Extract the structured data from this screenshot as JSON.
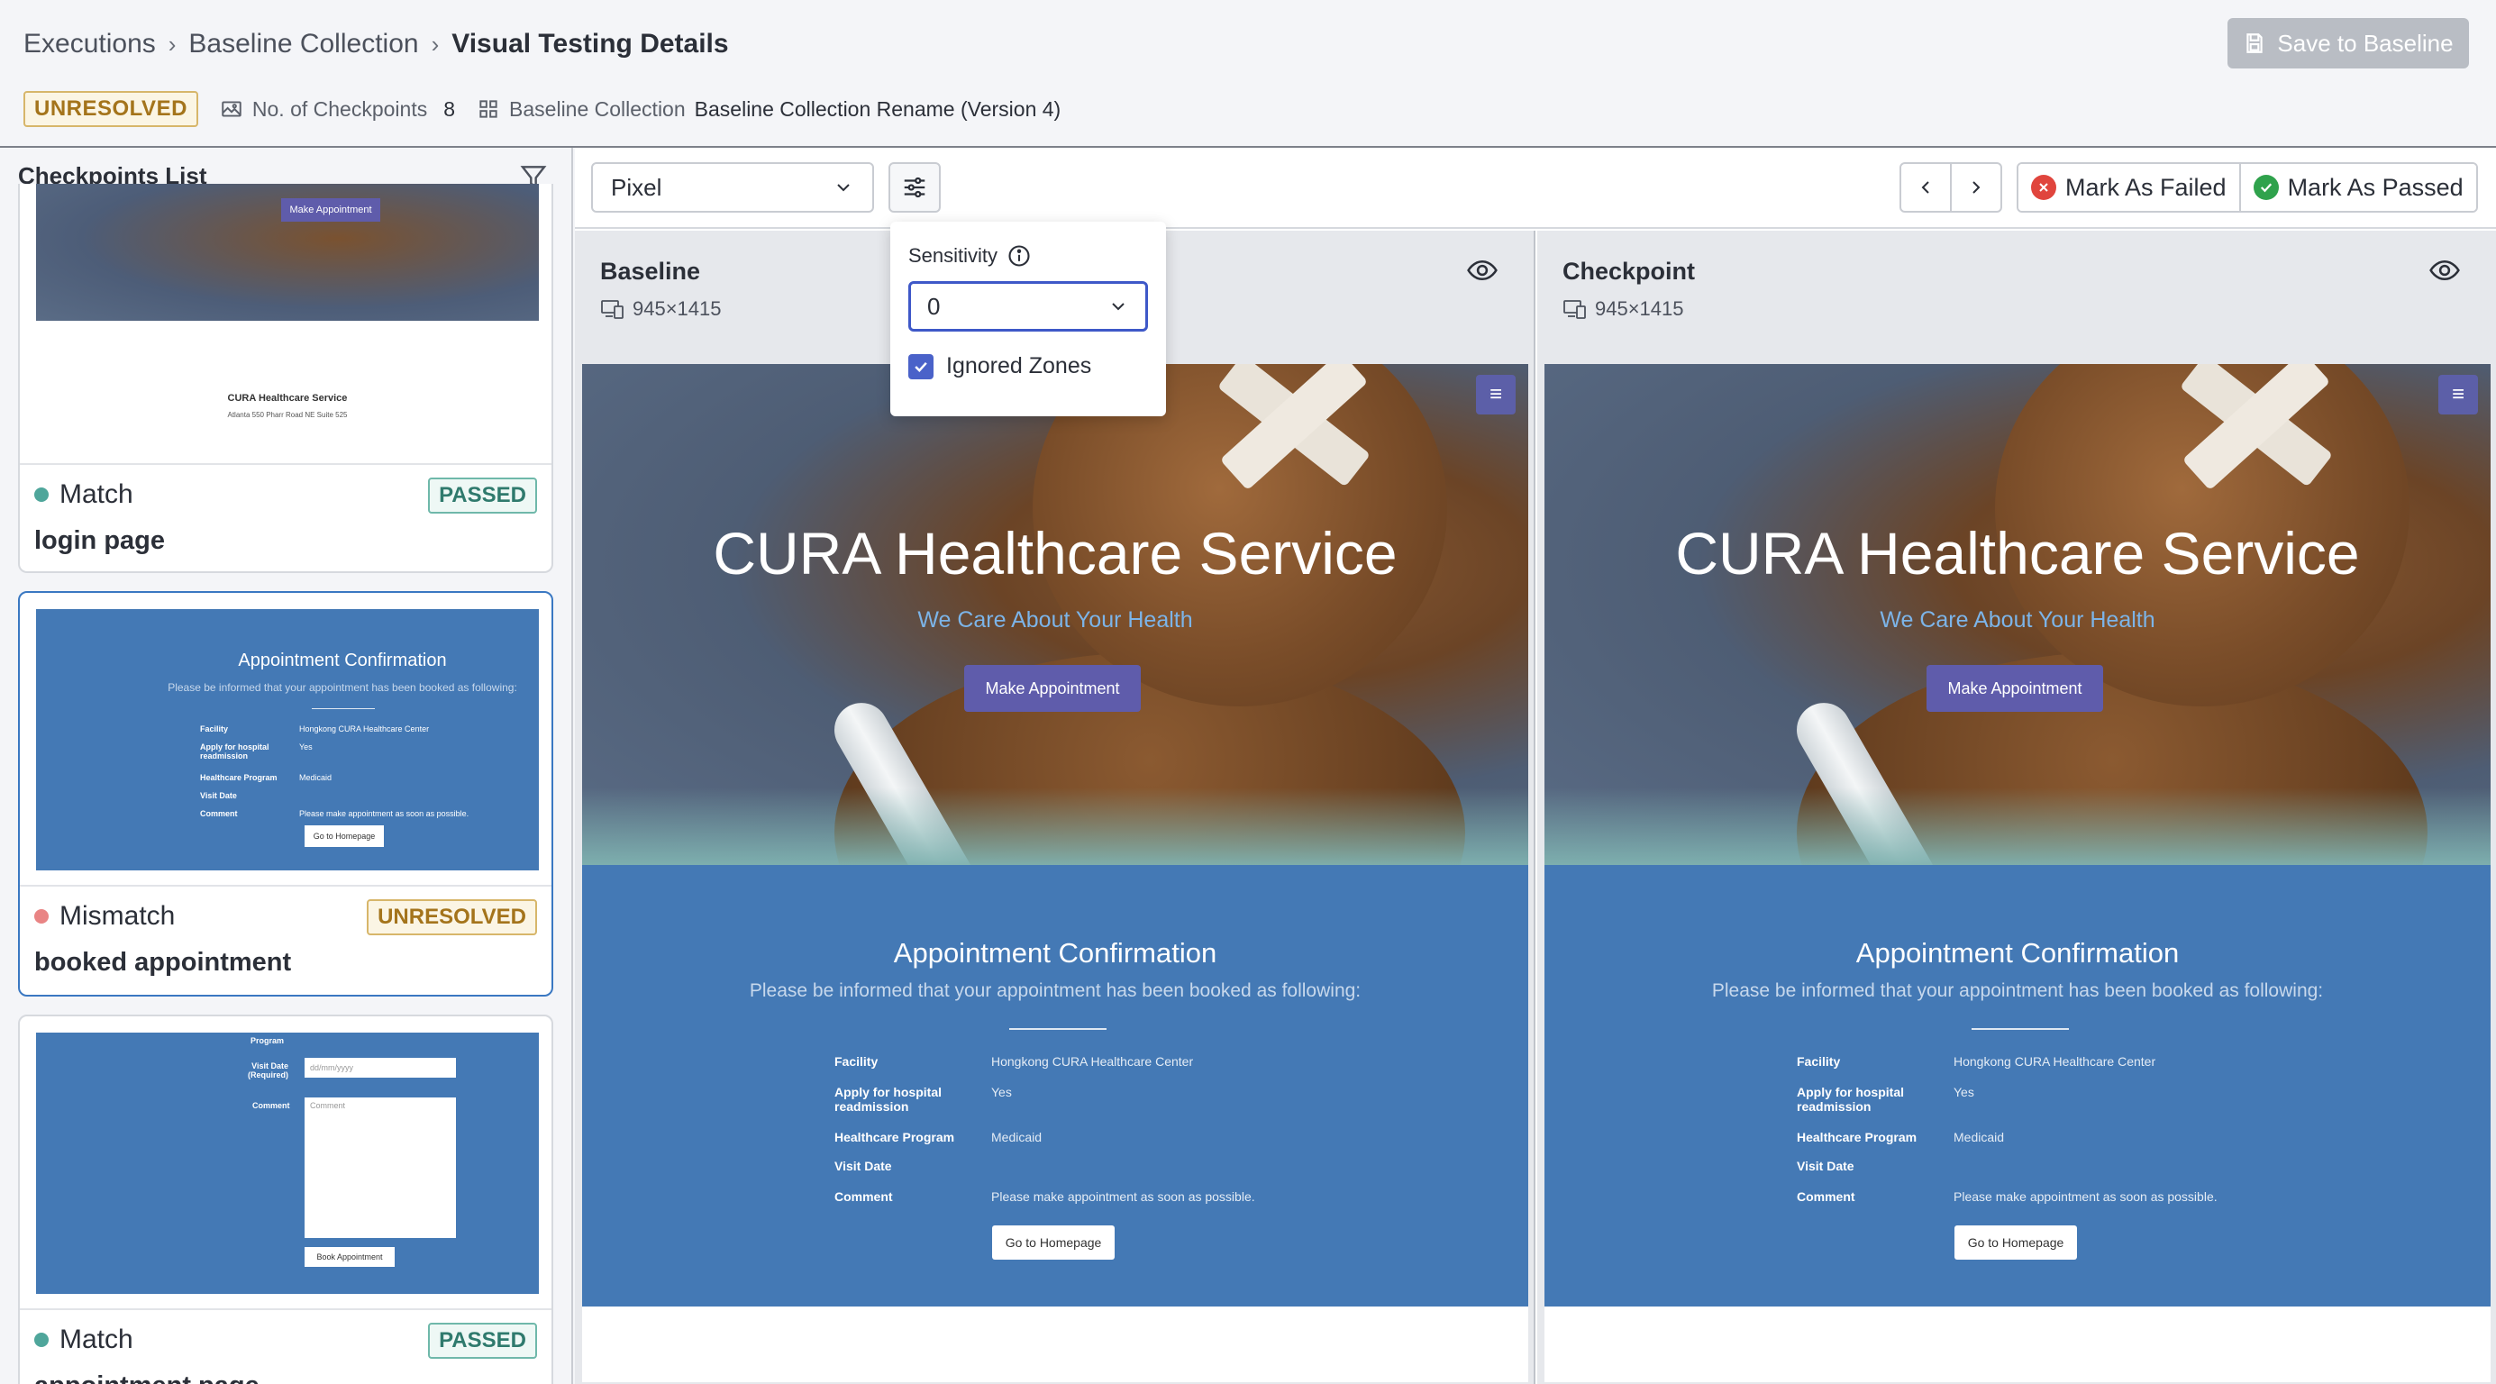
{
  "breadcrumb": {
    "items": [
      "Executions",
      "Baseline Collection"
    ],
    "current": "Visual Testing Details",
    "separator": "›"
  },
  "header": {
    "save_label": "Save to Baseline",
    "status_badge": "UNRESOLVED",
    "checkpoints_label": "No. of Checkpoints",
    "checkpoints_count": "8",
    "baseline_collection_label": "Baseline Collection",
    "baseline_collection_value": "Baseline Collection Rename (Version 4)"
  },
  "sidebar": {
    "title": "Checkpoints List",
    "cards": [
      {
        "status": "Match",
        "name": "login page",
        "badge": "PASSED",
        "thumb": {
          "button": "Make Appointment",
          "title": "CURA Healthcare Service",
          "address": "Atlanta 550 Pharr Road NE Suite 525"
        }
      },
      {
        "status": "Mismatch",
        "name": "booked appointment",
        "badge": "UNRESOLVED",
        "thumb": {
          "title": "Appointment Confirmation",
          "subtitle": "Please be informed that your appointment has been booked as following:",
          "rows": [
            {
              "k": "Facility",
              "v": "Hongkong CURA Healthcare Center"
            },
            {
              "k": "Apply for hospital readmission",
              "v": "Yes"
            },
            {
              "k": "Healthcare Program",
              "v": "Medicaid"
            },
            {
              "k": "Visit Date",
              "v": ""
            },
            {
              "k": "Comment",
              "v": "Please make appointment as soon as possible."
            }
          ],
          "button": "Go to Homepage"
        }
      },
      {
        "status": "Match",
        "name": "appointment page",
        "badge": "PASSED",
        "thumb": {
          "program": "Program",
          "visit_date": "Visit Date (Required)",
          "date_placeholder": "dd/mm/yyyy",
          "comment": "Comment",
          "comment_placeholder": "Comment",
          "button": "Book Appointment"
        }
      }
    ]
  },
  "toolbar": {
    "mode": "Pixel",
    "mark_failed": "Mark As Failed",
    "mark_passed": "Mark As Passed"
  },
  "popover": {
    "sensitivity_label": "Sensitivity",
    "sensitivity_value": "0",
    "ignored_zones_label": "Ignored Zones",
    "ignored_zones_checked": true
  },
  "panels": {
    "baseline": {
      "title": "Baseline",
      "dims": "945×1415"
    },
    "checkpoint": {
      "title": "Checkpoint",
      "dims": "945×1415"
    }
  },
  "screenshot": {
    "hero_title": "CURA Healthcare Service",
    "hero_sub": "We Care About Your Health",
    "hero_button": "Make Appointment",
    "confirm_title": "Appointment Confirmation",
    "confirm_sub": "Please be informed that your appointment has been booked as following:",
    "rows": [
      {
        "k": "Facility",
        "v": "Hongkong CURA Healthcare Center"
      },
      {
        "k": "Apply for hospital readmission",
        "v": "Yes"
      },
      {
        "k": "Healthcare Program",
        "v": "Medicaid"
      },
      {
        "k": "Visit Date",
        "v": ""
      },
      {
        "k": "Comment",
        "v": "Please make appointment as soon as possible."
      }
    ],
    "home_button": "Go to Homepage"
  },
  "colors": {
    "accent": "#3e58c8",
    "passed": "#2f7a6d",
    "unresolved": "#a4741b",
    "failed": "#e0453d",
    "success": "#2fa24c"
  },
  "icons": [
    "save-icon",
    "image-icon",
    "grid-icon",
    "filter-icon",
    "chevron-down-icon",
    "sliders-icon",
    "chevron-left-icon",
    "chevron-right-icon",
    "close-circle-icon",
    "check-circle-icon",
    "eye-icon",
    "devices-icon",
    "info-icon",
    "check-icon",
    "menu-icon"
  ]
}
